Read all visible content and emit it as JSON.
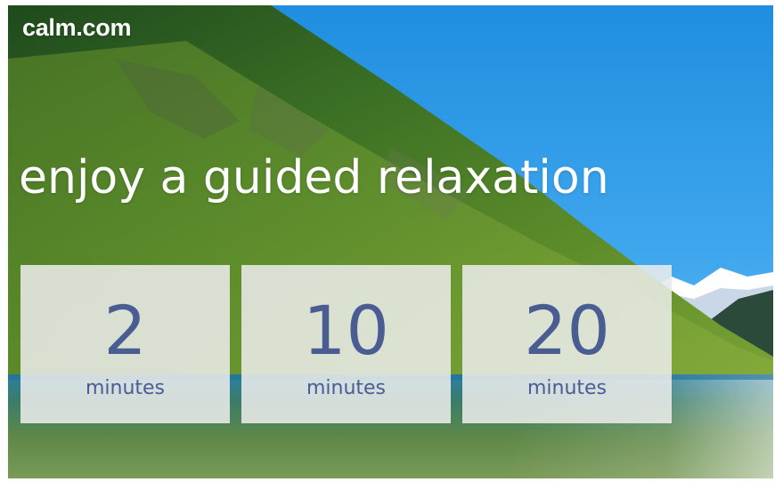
{
  "brand": {
    "logo_text": "calm.com"
  },
  "hero": {
    "headline": "enjoy a guided relaxation",
    "background": "mountain-lake-scene"
  },
  "options": [
    {
      "value": "2",
      "unit": "minutes"
    },
    {
      "value": "10",
      "unit": "minutes"
    },
    {
      "value": "20",
      "unit": "minutes"
    }
  ],
  "colors": {
    "tile_text": "#4a5d92",
    "tile_bg": "#eeeeec",
    "headline": "#ffffff"
  }
}
